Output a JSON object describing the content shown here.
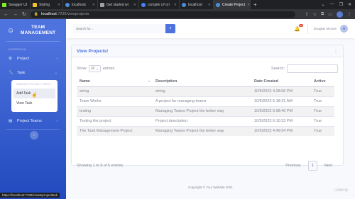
{
  "browser": {
    "tabs": [
      {
        "label": "Swagger UI",
        "color": "#85ea2d"
      },
      {
        "label": "Styling",
        "color": "#f0c030"
      },
      {
        "label": "localhost",
        "color": "#4a90d9"
      },
      {
        "label": "Get started wi",
        "color": "#a0a0a0"
      },
      {
        "label": "compile c# on",
        "color": "#4285f4"
      },
      {
        "label": "localhost",
        "color": "#4a90d9"
      },
      {
        "label": "Create Project",
        "color": "#4a90d9"
      }
    ],
    "url_host": "localhost",
    "url_path": ":7236/viewprojects",
    "status_url": "https://localhost:7236/createprojecttask"
  },
  "sidebar": {
    "brand_line1": "TEAM",
    "brand_line2": "MANAGEMENT",
    "heading": "INTERFACE",
    "items": [
      {
        "label": "Project",
        "icon": "gear-icon"
      },
      {
        "label": "Task",
        "icon": "wrench-icon"
      },
      {
        "label": "Project Teams",
        "icon": "folder-icon"
      }
    ],
    "submenu_heading": "MANAGE PROJECT TASKS",
    "submenu_items": [
      "Add Task",
      "View Task"
    ]
  },
  "topbar": {
    "search_placeholder": "Search for...",
    "alert_count": "3+",
    "user_name": "Douglas McGee"
  },
  "card": {
    "title": "View Projects!",
    "show_label": "Show",
    "entries_value": "10",
    "entries_label": "entries",
    "search_label": "Search:",
    "columns": [
      "Name",
      "Description",
      "Date Created",
      "Active"
    ],
    "rows": [
      [
        "string",
        "string",
        "10/5/2023 4:28:06 PM",
        "True"
      ],
      [
        "Team Works",
        "A project for managing teams",
        "10/6/2023 5:18:31 AM",
        "True"
      ],
      [
        "testing",
        "Managing Teams Project the better way",
        "10/5/2023 6:08:40 PM",
        "True"
      ],
      [
        "Testing the project",
        "Project description",
        "10/5/2023 6:10:33 PM",
        "True"
      ],
      [
        "The Task Management Project",
        "Managing Teams Project the better way",
        "10/5/2023 4:49:54 PM",
        "True"
      ]
    ],
    "info": "Showing 1 to 5 of 5 entries",
    "previous": "Previous",
    "page": "1",
    "next": "Next"
  },
  "footer": "Copyright © Your Website 2021",
  "watermark": "Udemy"
}
